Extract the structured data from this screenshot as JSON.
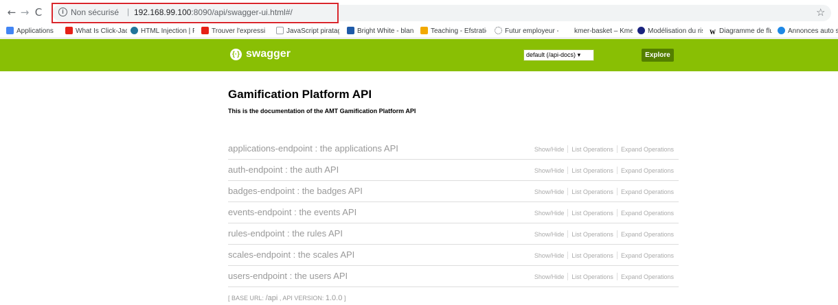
{
  "browser": {
    "security_label": "Non sécurisé",
    "url_host": "192.168.99.100",
    "url_rest": ":8090/api/swagger-ui.html#/",
    "highlight_color": "#d9262c"
  },
  "bookmarks": [
    {
      "label": "Applications",
      "icon": "apps-grid-icon",
      "color": "#4285f4"
    },
    {
      "label": "What Is Click-Jacking",
      "icon": "youtube-icon",
      "color": "#e62117"
    },
    {
      "label": "HTML Injection | Pen",
      "icon": "wordpress-icon",
      "color": "#21759b"
    },
    {
      "label": "Trouver l'expression",
      "icon": "youtube-icon",
      "color": "#e62117"
    },
    {
      "label": "JavaScript piratage",
      "icon": "page-icon",
      "color": "#9aa0a6"
    },
    {
      "label": "Bright White - blanch",
      "icon": "colorhexa-icon",
      "color": "#1e5aa8"
    },
    {
      "label": "Teaching - Efstratios",
      "icon": "teaching-icon",
      "color": "#f2a900"
    },
    {
      "label": "Futur employeur - w",
      "icon": "loading-icon",
      "color": "#5f6368"
    },
    {
      "label": "kmer-basket – Kmer",
      "icon": "none",
      "color": "#ffffff"
    },
    {
      "label": "Modélisation du risq",
      "icon": "globe-icon",
      "color": "#1a237e"
    },
    {
      "label": "Diagramme de flux d",
      "icon": "wikipedia-icon",
      "color": "#000000"
    },
    {
      "label": "Annonces auto sk",
      "icon": "yahoo-icon",
      "color": "#1e88e5"
    }
  ],
  "header": {
    "brand": "swagger",
    "select_value": "default (/api-docs)",
    "explore_label": "Explore",
    "bg_color": "#89bf04",
    "button_color": "#547f00"
  },
  "main": {
    "title": "Gamification Platform API",
    "description": "This is the documentation of the AMT Gamification Platform API",
    "actions": {
      "show_hide": "Show/Hide",
      "list_ops": "List Operations",
      "expand_ops": "Expand Operations"
    },
    "endpoints": [
      {
        "name": "applications-endpoint : the applications API"
      },
      {
        "name": "auth-endpoint : the auth API"
      },
      {
        "name": "badges-endpoint : the badges API"
      },
      {
        "name": "events-endpoint : the events API"
      },
      {
        "name": "rules-endpoint : the rules API"
      },
      {
        "name": "scales-endpoint : the scales API"
      },
      {
        "name": "users-endpoint : the users API"
      }
    ],
    "footer": {
      "base_url_label": "BASE URL:",
      "base_url": "/api",
      "api_version_label": "API VERSION:",
      "api_version": "1.0.0"
    }
  }
}
